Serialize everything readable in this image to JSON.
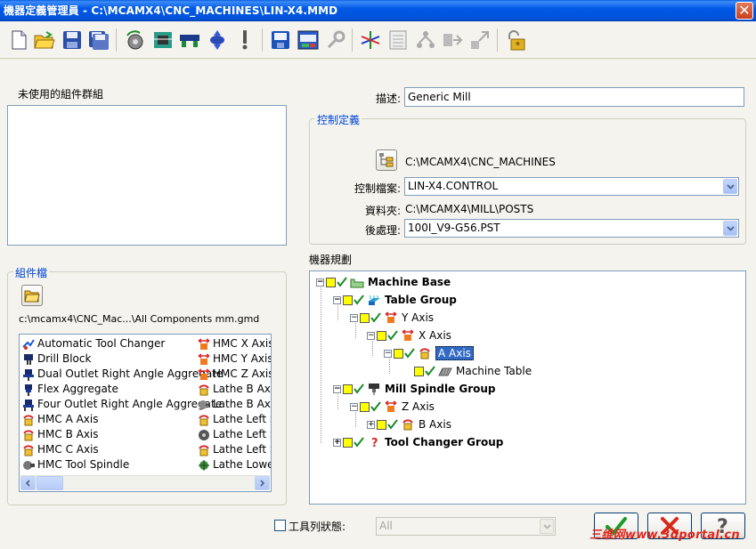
{
  "window": {
    "title": "機器定義管理員 - C:\\MCAMX4\\CNC_MACHINES\\LIN-X4.MMD"
  },
  "toolbar": {
    "icons": [
      "new-file-icon",
      "open-folder-icon",
      "save-icon",
      "save-as-icon",
      "rotary-axis-icon",
      "linear-component-icon",
      "spindle-component-icon",
      "axis-component-icon",
      "warning-icon",
      "floppy-icon",
      "properties-icon",
      "tool-wrench-icon",
      "axes-icon",
      "list-icon",
      "tree-node-icon",
      "arrow-right-icon",
      "arrow-diagonal-icon",
      "lock-icon"
    ]
  },
  "unused_groups": {
    "label": "未使用的組件群組"
  },
  "component_file": {
    "legend": "組件檔",
    "path": "c:\\mcamx4\\CNC_Mac...\\All Components mm.gmd",
    "items_col1": [
      "Automatic Tool Changer",
      "Drill Block",
      "Dual Outlet Right Angle Aggregate",
      "Flex Aggregate",
      "Four Outlet Right Angle Aggregate",
      "HMC A Axis",
      "HMC B Axis",
      "HMC C Axis",
      "HMC Tool Spindle"
    ],
    "items_col2": [
      "HMC X Axis",
      "HMC Y Axis",
      "HMC Z Axis",
      "Lathe B Axis A",
      "Lathe B Axis T",
      "Lathe Left Sp",
      "Lathe Left Sp",
      "Lathe Left Sp",
      "Lathe Lower T"
    ]
  },
  "description": {
    "label": "描述:",
    "value": "Generic Mill"
  },
  "control_def": {
    "legend": "控制定義",
    "path": "C:\\MCAMX4\\CNC_MACHINES",
    "control_file_label": "控制檔案:",
    "control_file_value": "LIN-X4.CONTROL",
    "folder_label": "資料夾:",
    "folder_value": "C:\\MCAMX4\\MILL\\POSTS",
    "post_label": "後處理:",
    "post_value": "100I_V9-G56.PST"
  },
  "machine_config": {
    "label": "機器規劃",
    "tree": [
      {
        "label": "Machine Base",
        "bold": true
      },
      {
        "label": "Table Group",
        "bold": true
      },
      {
        "label": "Y Axis",
        "bold": false
      },
      {
        "label": "X Axis",
        "bold": false
      },
      {
        "label": "A Axis",
        "bold": false
      },
      {
        "label": "Machine Table",
        "bold": false
      },
      {
        "label": "Mill Spindle Group",
        "bold": true
      },
      {
        "label": "Z Axis",
        "bold": false
      },
      {
        "label": "B Axis",
        "bold": false
      },
      {
        "label": "Tool Changer Group",
        "bold": true
      }
    ]
  },
  "bottom": {
    "toolbar_state_label": "工具列狀態:",
    "toolbar_state_value": "All",
    "watermark": "三维网www.3dportal.cn"
  }
}
